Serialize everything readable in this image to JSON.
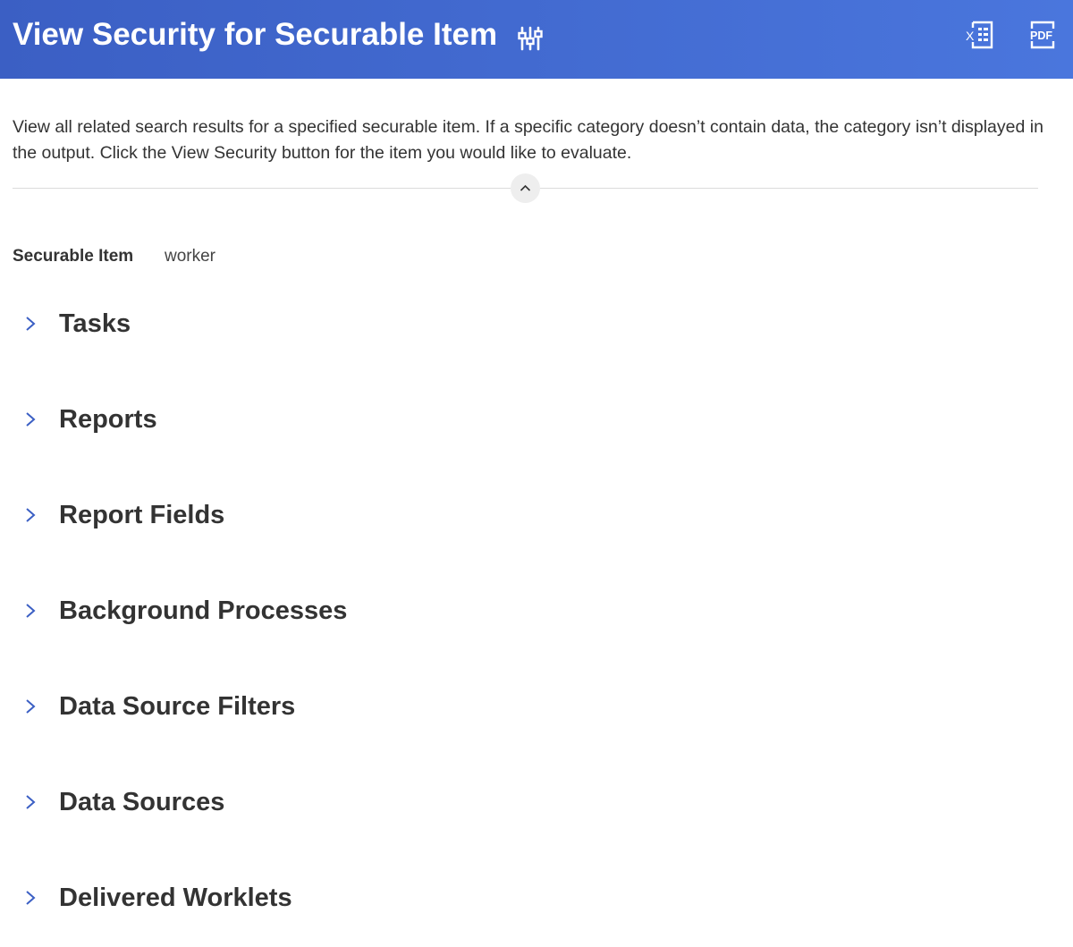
{
  "header": {
    "title": "View Security for Securable Item",
    "icons": {
      "related_actions": "related-actions-icon",
      "excel": "excel-export-icon",
      "pdf": "pdf-export-icon"
    },
    "pdf_icon_text": "PDF",
    "excel_icon_text": "X"
  },
  "description": "View all related search results for a specified securable item. If a specific category doesn’t contain data, the category isn’t displayed in the output. Click the View Security button for the item you would like to evaluate.",
  "field": {
    "label": "Securable Item",
    "value": "worker"
  },
  "sections": [
    {
      "label": "Tasks"
    },
    {
      "label": "Reports"
    },
    {
      "label": "Report Fields"
    },
    {
      "label": "Background Processes"
    },
    {
      "label": "Data Source Filters"
    },
    {
      "label": "Data Sources"
    },
    {
      "label": "Delivered Worklets"
    }
  ],
  "colors": {
    "header_start": "#3b5fc4",
    "header_end": "#4a76dd",
    "chevron": "#3b5fc4",
    "text": "#333333"
  }
}
